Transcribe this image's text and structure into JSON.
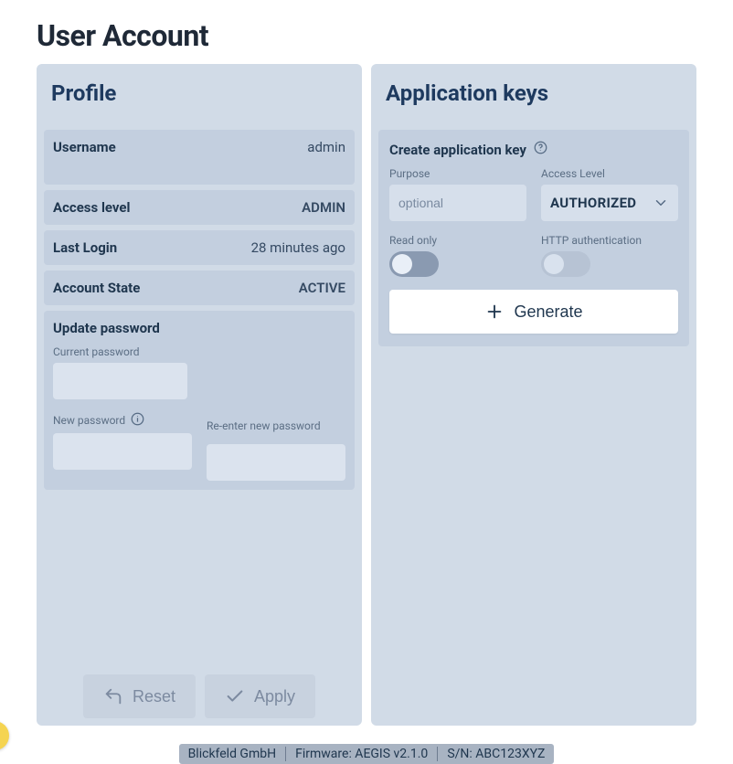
{
  "pageTitle": "User Account",
  "profile": {
    "title": "Profile",
    "username": {
      "label": "Username",
      "value": "admin"
    },
    "accessLevel": {
      "label": "Access level",
      "value": "ADMIN"
    },
    "lastLogin": {
      "label": "Last Login",
      "value": "28 minutes ago"
    },
    "accountState": {
      "label": "Account State",
      "value": "ACTIVE"
    },
    "updatePassword": {
      "title": "Update password",
      "currentLabel": "Current password",
      "newLabel": "New password",
      "reenterLabel": "Re-enter new password"
    },
    "buttons": {
      "reset": "Reset",
      "apply": "Apply"
    }
  },
  "appKeys": {
    "title": "Application keys",
    "createTitle": "Create application key",
    "purpose": {
      "label": "Purpose",
      "placeholder": "optional",
      "value": ""
    },
    "accessLevel": {
      "label": "Access Level",
      "selected": "AUTHORIZED"
    },
    "readOnly": {
      "label": "Read only",
      "value": false
    },
    "httpAuth": {
      "label": "HTTP authentication",
      "value": false
    },
    "generate": "Generate"
  },
  "footer": {
    "company": "Blickfeld GmbH",
    "firmware": "Firmware: AEGIS v2.1.0",
    "serial": "S/N: ABC123XYZ"
  }
}
